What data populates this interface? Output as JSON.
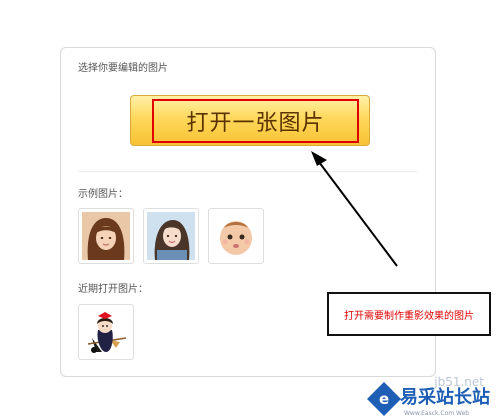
{
  "panel": {
    "heading": "选择你要编辑的图片",
    "open_button_label": "打开一张图片",
    "examples_label": "示例图片：",
    "examples": [
      {
        "icon": "woman-portrait-icon"
      },
      {
        "icon": "girl-portrait-icon"
      },
      {
        "icon": "baby-portrait-icon"
      }
    ],
    "recent_label": "近期打开图片：",
    "recent": [
      {
        "icon": "anime-witch-icon"
      }
    ]
  },
  "annotation": {
    "callout_text": "打开需要制作重影效果的图片",
    "callout_color": "#e00000"
  },
  "watermark": {
    "url": "jb51.net",
    "site_name": "易采站长站",
    "site_sub": "Www.Easck.Com  Web",
    "logo_color": "#1e5fb5"
  },
  "colors": {
    "button_highlight": "#e10000",
    "button_fill": "#ffd85c"
  }
}
